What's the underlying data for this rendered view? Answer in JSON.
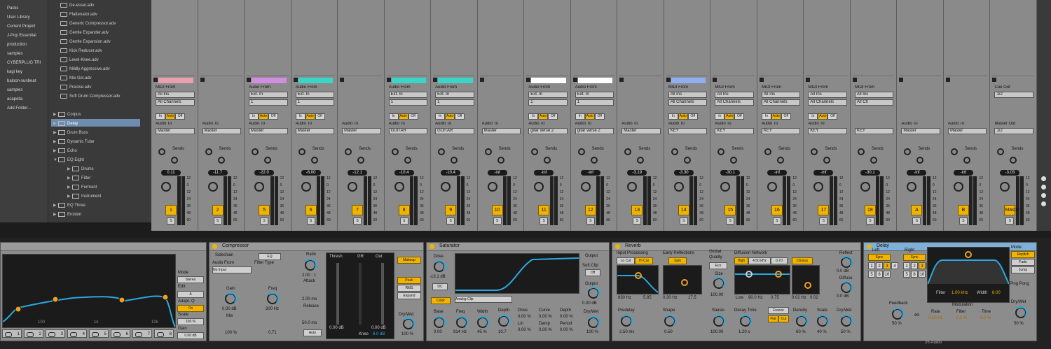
{
  "browser": {
    "places": [
      "Packs",
      "User Library",
      "Current Project",
      "J-Pop Essential",
      "production",
      "samples",
      "CYBERPLUG TRI",
      "kagi key",
      "baloon-sunbeat",
      "samples",
      "acapella",
      "Add Folder..."
    ],
    "files": [
      "De-esser.adv",
      "Flattenator.adv",
      "Generic Compressor.adv",
      "Gentle Expander.adv",
      "Gentle Expansion.adv",
      "Kick Reducer.adv",
      "Level-Knee.adv",
      "Mildly Aggressive.adv",
      "Mix Gel.adv",
      "Precise.adv",
      "Soft Drum Compressor.adv"
    ],
    "folders": [
      {
        "label": "Corpus",
        "caret": "▶"
      },
      {
        "label": "Delay",
        "caret": "▶",
        "selected": true
      },
      {
        "label": "Drum Buss",
        "caret": "▶"
      },
      {
        "label": "Dynamic Tube",
        "caret": "▶"
      },
      {
        "label": "Echo",
        "caret": "▶"
      },
      {
        "label": "EQ Eight",
        "caret": "▼"
      },
      {
        "label": "Drums",
        "caret": "▶"
      },
      {
        "label": "Filter",
        "caret": "▶"
      },
      {
        "label": "Formant",
        "caret": "▶"
      },
      {
        "label": "Instrument",
        "caret": "▶"
      },
      {
        "label": "EQ Three",
        "caret": "▶"
      },
      {
        "label": "Erosion",
        "caret": "▶"
      }
    ]
  },
  "mixer": {
    "sends_label": "Sends",
    "strips": [
      {
        "num": "1",
        "vol": "0.11",
        "color": "#e8a0b0",
        "io_top": "MIDI From",
        "io_src": "All Ins",
        "io_ch": "All Channels",
        "out_lbl": "Audio To",
        "out": "Master",
        "mon": [
          "In",
          "Auto",
          "Off"
        ]
      },
      {
        "num": "2",
        "vol": "-11.7",
        "color": "",
        "io_top": "",
        "io_src": "",
        "io_ch": "",
        "out_lbl": "Audio To",
        "out": "Master",
        "mon": []
      },
      {
        "num": "5",
        "vol": "-22.0",
        "color": "#d28ce0",
        "io_top": "Audio From",
        "io_src": "Ext. In",
        "io_ch": "1",
        "out_lbl": "Audio To",
        "out": "Master",
        "mon": [
          "In",
          "Auto",
          "Off"
        ]
      },
      {
        "num": "6",
        "vol": "-6.00",
        "color": "#39d6c8",
        "io_top": "Audio From",
        "io_src": "Ext. In",
        "io_ch": "1",
        "out_lbl": "Audio To",
        "out": "Master",
        "mon": [
          "In",
          "Auto",
          "Off"
        ]
      },
      {
        "num": "7",
        "vol": "-12.1",
        "color": "",
        "io_top": "",
        "io_src": "",
        "io_ch": "",
        "out_lbl": "Audio To",
        "out": "Master",
        "mon": []
      },
      {
        "num": "8",
        "vol": "-10.4",
        "color": "#39d6c8",
        "io_top": "Audio From",
        "io_src": "Ext. In",
        "io_ch": "1",
        "out_lbl": "Audio To",
        "out": "GUITAR",
        "mon": [
          "In",
          "Auto",
          "Off"
        ]
      },
      {
        "num": "9",
        "vol": "-10.4",
        "color": "#39d6c8",
        "io_top": "Audio From",
        "io_src": "Ext. In",
        "io_ch": "1",
        "out_lbl": "Audio To",
        "out": "GUITAR",
        "mon": [
          "In",
          "Auto",
          "Off"
        ]
      },
      {
        "num": "10",
        "vol": "-inf",
        "color": "",
        "io_top": "",
        "io_src": "",
        "io_ch": "",
        "out_lbl": "Audio To",
        "out": "Master",
        "mon": []
      },
      {
        "num": "11",
        "vol": "-inf",
        "color": "#ffffff",
        "io_top": "Audio From",
        "io_src": "Ext. In",
        "io_ch": "1",
        "out_lbl": "Audio To",
        "out": "gitar verse 2",
        "mon": [
          "In",
          "Auto",
          "Off"
        ]
      },
      {
        "num": "12",
        "vol": "-inf",
        "color": "#ffffff",
        "io_top": "Audio From",
        "io_src": "Ext. In",
        "io_ch": "1",
        "out_lbl": "Audio To",
        "out": "gitar verse 2",
        "mon": [
          "In",
          "Auto",
          "Off"
        ]
      },
      {
        "num": "13",
        "vol": "-3.19",
        "color": "",
        "io_top": "",
        "io_src": "",
        "io_ch": "",
        "out_lbl": "Audio To",
        "out": "Master",
        "mon": []
      },
      {
        "num": "14",
        "vol": "-3.30",
        "color": "#8fb0f0",
        "io_top": "MIDI From",
        "io_src": "All Ins",
        "io_ch": "All Channels",
        "out_lbl": "Audio To",
        "out": "KEY",
        "mon": [
          "In",
          "Auto",
          "Off"
        ]
      },
      {
        "num": "15",
        "vol": "-30.1",
        "color": "",
        "io_top": "MIDI From",
        "io_src": "All Ins",
        "io_ch": "All Channels",
        "out_lbl": "Audio To",
        "out": "KEY",
        "mon": [
          "In",
          "Auto",
          "Off"
        ]
      },
      {
        "num": "16",
        "vol": "-inf",
        "color": "",
        "io_top": "MIDI From",
        "io_src": "All Ins",
        "io_ch": "All Channels",
        "out_lbl": "Audio To",
        "out": "KEY",
        "mon": [
          "In",
          "Auto",
          "Off"
        ]
      },
      {
        "num": "17",
        "vol": "-inf",
        "color": "",
        "io_top": "MIDI From",
        "io_src": "All Ins",
        "io_ch": "All Channels",
        "out_lbl": "Audio To",
        "out": "KEY",
        "mon": [
          "In",
          "Auto",
          "Off"
        ]
      },
      {
        "num": "18",
        "vol": "-30.1",
        "color": "",
        "io_top": "MIDI From",
        "io_src": "All Ins",
        "io_ch": "All Ch",
        "out_lbl": "",
        "out": "KEY",
        "mon": []
      },
      {
        "num": "A",
        "vol": "-inf",
        "color": "",
        "io_top": "",
        "io_src": "",
        "io_ch": "",
        "out_lbl": "Audio To",
        "out": "Master",
        "mon": []
      },
      {
        "num": "B",
        "vol": "-inf",
        "color": "",
        "io_top": "",
        "io_src": "",
        "io_ch": "",
        "out_lbl": "Audio To",
        "out": "Master",
        "mon": []
      },
      {
        "num": "Master",
        "vol": "-3.03",
        "color": "",
        "io_top": "Cue Out",
        "io_src": "1/2",
        "io_ch": "",
        "out_lbl": "Master Out",
        "out": "1/2",
        "mon": []
      }
    ],
    "scale": [
      "12",
      "0",
      "12",
      "24",
      "36",
      "48",
      "60"
    ]
  },
  "devices": {
    "eq": {
      "mode_label": "Mode",
      "mode": "Stereo",
      "edit_label": "Edit",
      "edit_value": "A",
      "adapt_label": "Adapt. Q",
      "adapt_value": "On",
      "scale_label": "Scale",
      "scale_value": "100 %",
      "gain_label": "Gain",
      "gain_value": "0.00 dB",
      "freq_labels": [
        "100",
        "1k",
        "10k"
      ],
      "bands": [
        "1",
        "2",
        "3",
        "4",
        "5",
        "6",
        "7",
        "8"
      ]
    },
    "comp": {
      "title": "Compressor",
      "sidechain": "Sidechain",
      "eq": "EQ",
      "audio_from": "Audio From",
      "no_input": "No Input",
      "filter_type": "Filter Type",
      "gain_label": "Gain",
      "gain": "0.00 dB",
      "mix_label": "Mix",
      "mix": "100 %",
      "freq_label": "Freq",
      "freq": "200 Hz",
      "q": "0.71",
      "ratio_label": "Ratio",
      "ratio": "2.00 : 1",
      "attack_label": "Attack",
      "attack": "2.00 ms",
      "release_label": "Release",
      "release": "50.0 ms",
      "auto": "Auto",
      "thresh": "Thresh",
      "gr": "GR",
      "out": "Out",
      "thresh_val": "0.00 dB",
      "out_val": "0.00 dB",
      "knee_label": "Knee",
      "knee": "6.0 dB",
      "makeup": "Makeup",
      "peak": "Peak",
      "rms": "RMS",
      "expand": "Expand",
      "drywet_label": "Dry/Wet",
      "drywet": "100 %"
    },
    "sat": {
      "title": "Saturator",
      "drive_label": "Drive",
      "drive": "-13.1 dB",
      "dc": "DC",
      "color": "Color",
      "type": "Analog Clip",
      "base_label": "Base",
      "base": "0.00",
      "freq_label": "Freq",
      "freq": "914 Hz",
      "width_label": "Width",
      "width": "45 %",
      "depth_label": "Depth",
      "depth": "10.7",
      "drive2_label": "Drive",
      "curve_label": "Curve",
      "depth2_label": "Depth",
      "drive2": "0.00 %",
      "curve": "0.00 %",
      "depth2": "0.00 %",
      "lin_label": "Lin",
      "damp_label": "Damp",
      "period_label": "Period",
      "lin": "0.00 %",
      "damp": "0.00 %",
      "period": "0.00 %",
      "output_label": "Output",
      "softclip": "Soft Clip",
      "off": "Off",
      "output": "0.00 dB",
      "drywet_label": "Dry/Wet",
      "drywet": "100 %"
    },
    "reverb": {
      "title": "Reverb",
      "input_proc": "Input Processing",
      "lo_cut": "Lo Cut",
      "hi_cut": "Hi Cut",
      "early": "Early Reflections",
      "spin": "Spin",
      "global": "Global",
      "quality": "Quality",
      "quality_val": "Eco",
      "size_label": "Size",
      "size": "100.00",
      "diff": "Diffusion Network",
      "high": "High",
      "high_freq": "4.50 kHz",
      "high_val": "0.70",
      "chorus": "Chorus",
      "f1": "830 Hz",
      "f2": "5.85",
      "e1": "0.30 Hz",
      "e2": "17.5",
      "low": "Low",
      "low_freq": "90.0 Hz",
      "low_val": "0.75",
      "c1": "0.02 Hz",
      "c2": "0.02",
      "reflect": "Reflect",
      "reflect_val": "0.0 dB",
      "diffuse": "Diffuse",
      "diffuse_val": "0.0 dB",
      "predelay_label": "Predelay",
      "predelay": "2.50 ms",
      "shape_label": "Shape",
      "shape": "0.50",
      "stereo_label": "Stereo",
      "stereo": "100.00",
      "decay_label": "Decay Time",
      "decay": "1.20 s",
      "freeze": "Freeze",
      "flat": "Flat",
      "cut": "Cut",
      "density_label": "Density",
      "density": "60 %",
      "scale_label": "Scale",
      "scale": "40 %",
      "drywet_label": "Dry/Wet",
      "drywet": "50 %"
    },
    "delay": {
      "title": "Delay",
      "left": "Left",
      "right": "Right",
      "sync": "Sync",
      "left_keys": [
        "1",
        "2",
        "3",
        "4",
        "5",
        "8",
        "16"
      ],
      "right_keys": [
        "1",
        "2",
        "3",
        "4",
        "5",
        "8",
        "16"
      ],
      "feedback_label": "Feedback",
      "feedback": "50 %",
      "mode_label": "Mode",
      "mode": "Repitch",
      "fade": "Fade",
      "jump": "Jump",
      "pingpong": "Ping Pong",
      "filter": "Filter",
      "filter_freq": "1.00 kHz",
      "width_label": "Width",
      "width": "8.00",
      "modulation": "Modulation",
      "rate_label": "Rate",
      "rate": "0.50 Hz",
      "filter2_label": "Filter",
      "filter2": "0.0 %",
      "time_label": "Time",
      "time": "0.0 %",
      "drywet_label": "Dry/Wet",
      "drywet": "50 %"
    },
    "status": "25-Audio"
  }
}
